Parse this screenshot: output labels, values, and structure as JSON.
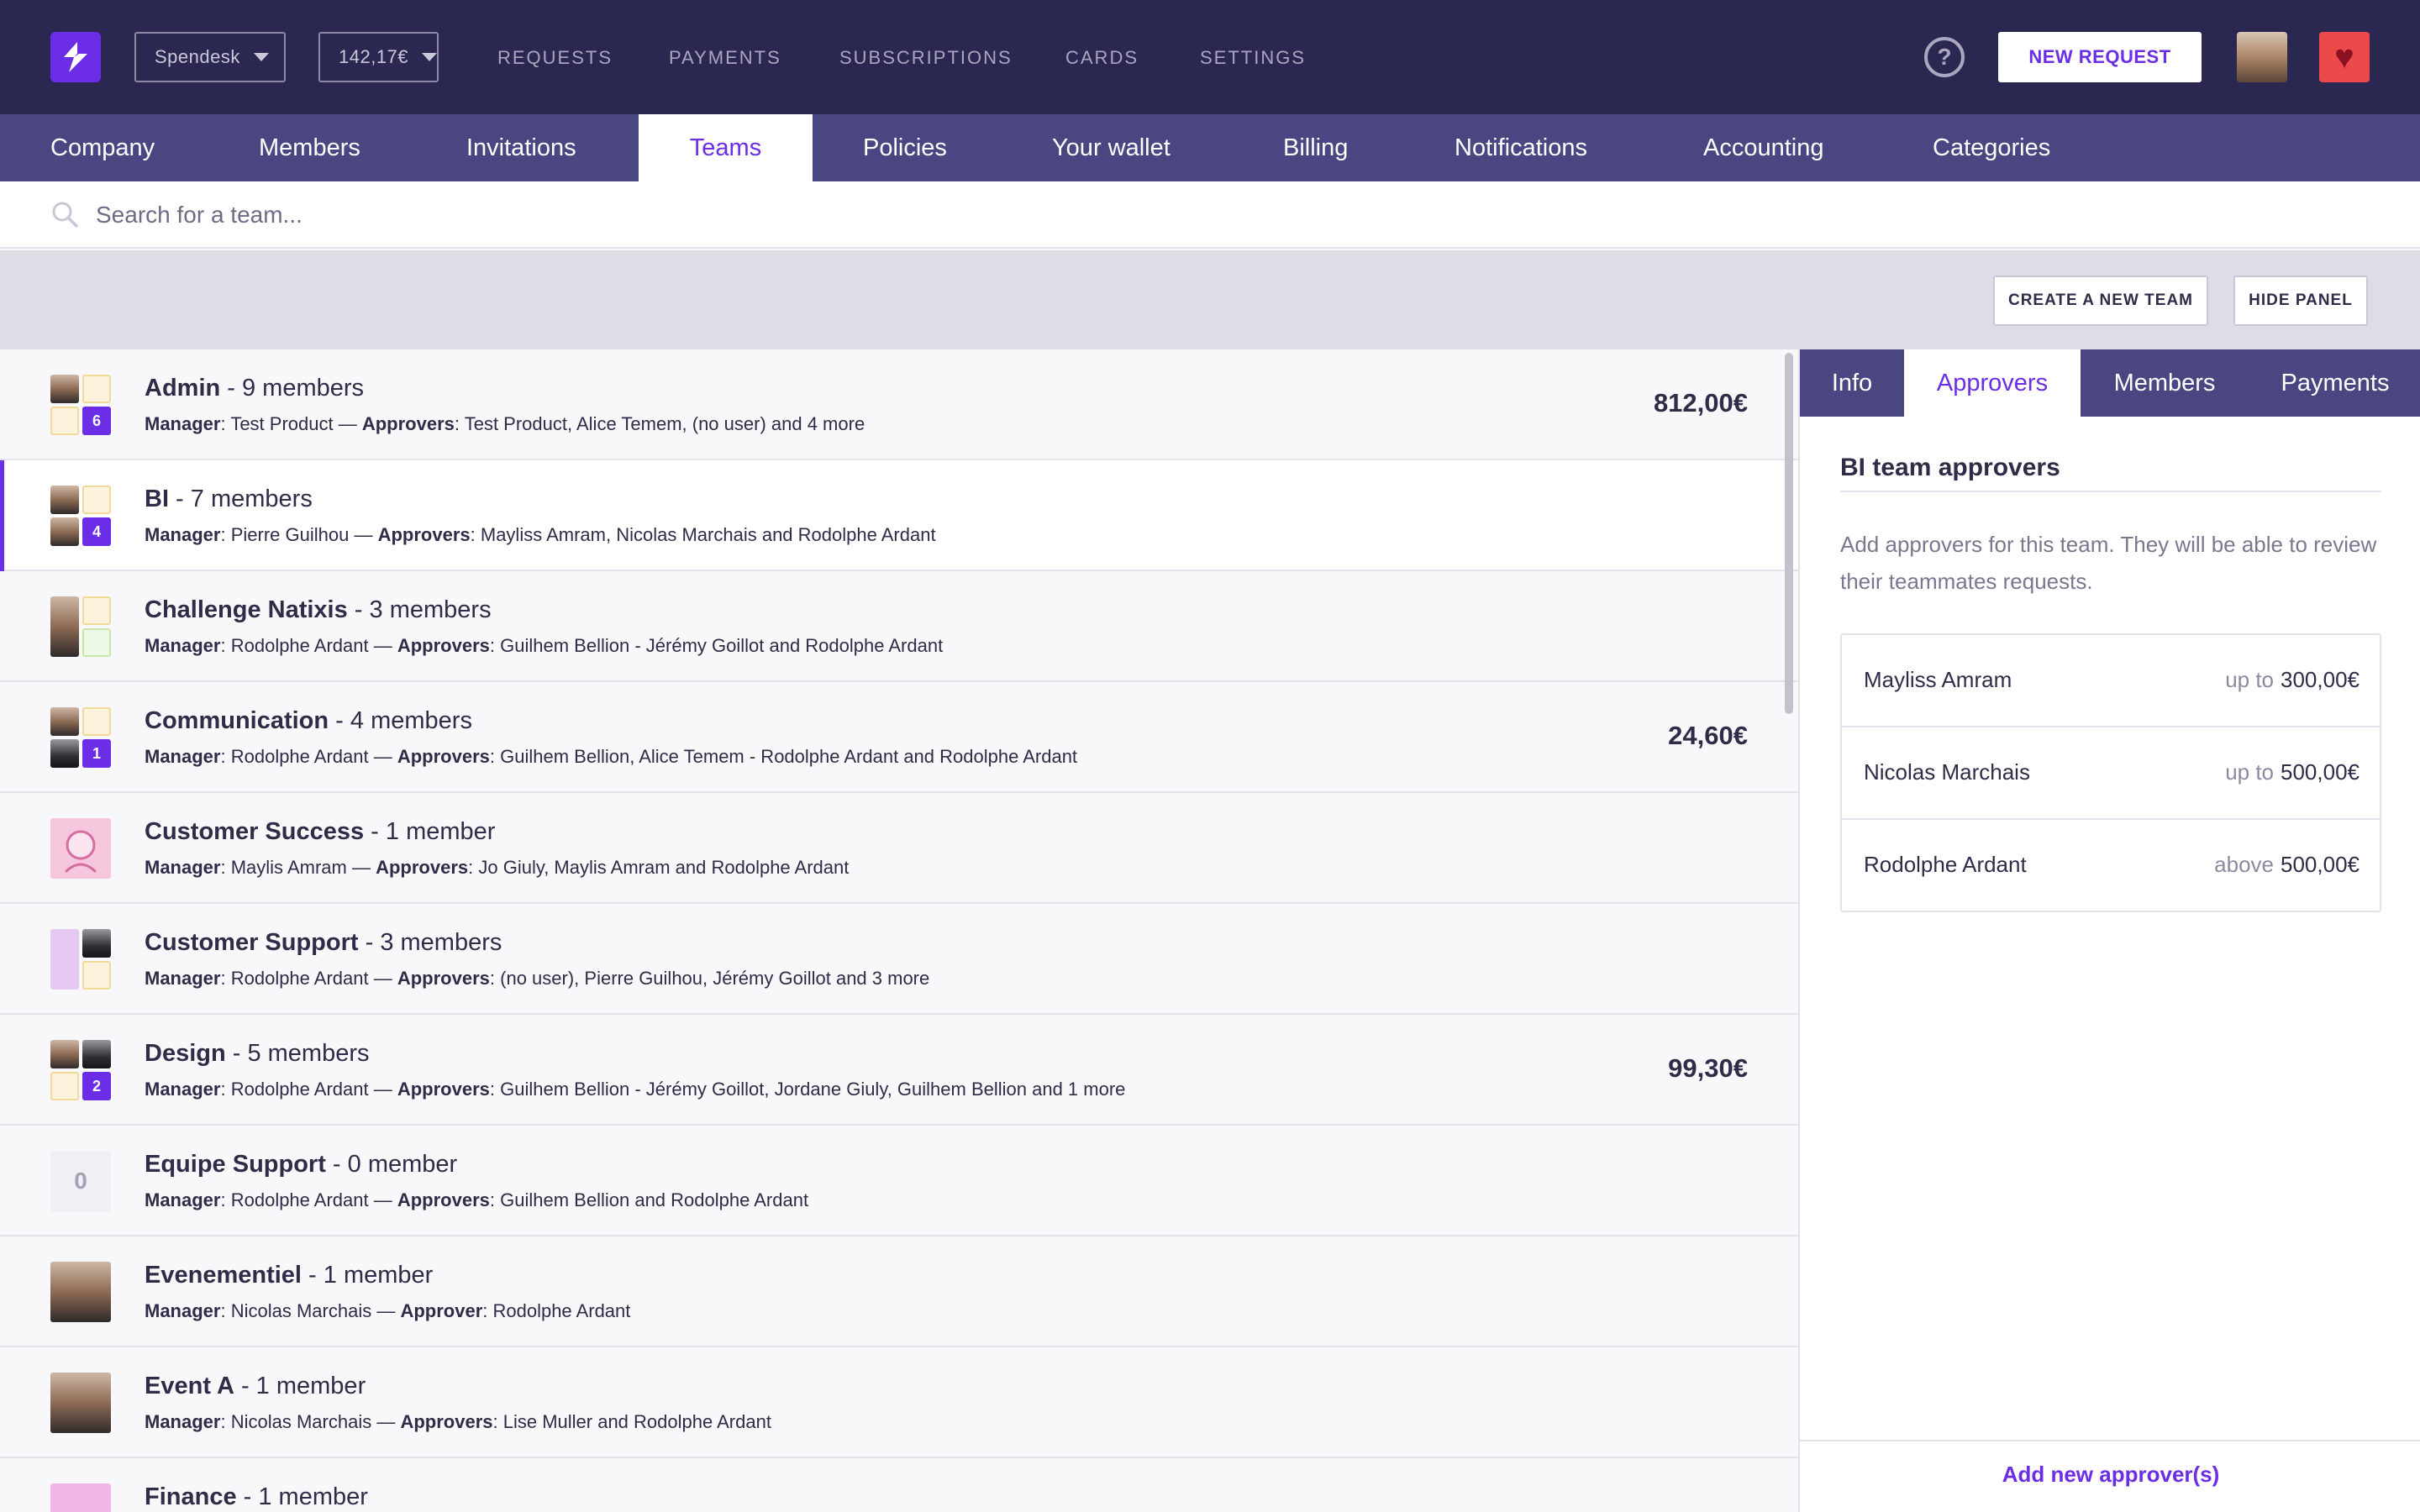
{
  "topbar": {
    "company_select": "Spendesk",
    "balance_select": "142,17€",
    "nav": [
      "REQUESTS",
      "PAYMENTS",
      "SUBSCRIPTIONS",
      "CARDS",
      "SETTINGS"
    ],
    "help_glyph": "?",
    "new_request_label": "NEW REQUEST",
    "heart_glyph": "♥"
  },
  "settings_tabs": [
    "Company",
    "Members",
    "Invitations",
    "Teams",
    "Policies",
    "Your wallet",
    "Billing",
    "Notifications",
    "Accounting",
    "Categories"
  ],
  "active_settings_tab": "Teams",
  "search": {
    "placeholder": "Search for a team..."
  },
  "actions": {
    "create_label": "CREATE A NEW TEAM",
    "hide_label": "HIDE PANEL"
  },
  "teams": [
    {
      "name": "Admin",
      "members": " - 9 members",
      "manager_label": "Manager",
      "manager": "Test Product",
      "approvers_label": "Approvers",
      "approvers": "Test Product, Alice Temem, (no user) and 4 more",
      "amount": "812,00€",
      "avatar_count": "6"
    },
    {
      "name": "BI",
      "members": " - 7 members",
      "manager_label": "Manager",
      "manager": "Pierre Guilhou",
      "approvers_label": "Approvers",
      "approvers": "Mayliss Amram, Nicolas Marchais and Rodolphe Ardant",
      "amount": "",
      "avatar_count": "4"
    },
    {
      "name": "Challenge Natixis",
      "members": " - 3 members",
      "manager_label": "Manager",
      "manager": "Rodolphe Ardant",
      "approvers_label": "Approvers",
      "approvers": "Guilhem Bellion - Jérémy Goillot and Rodolphe Ardant",
      "amount": "",
      "avatar_count": ""
    },
    {
      "name": "Communication",
      "members": " - 4 members",
      "manager_label": "Manager",
      "manager": "Rodolphe Ardant",
      "approvers_label": "Approvers",
      "approvers": "Guilhem Bellion, Alice Temem - Rodolphe Ardant and Rodolphe Ardant",
      "amount": "24,60€",
      "avatar_count": "1"
    },
    {
      "name": "Customer Success",
      "members": " - 1 member",
      "manager_label": "Manager",
      "manager": "Maylis Amram",
      "approvers_label": "Approvers",
      "approvers": "Jo Giuly, Maylis Amram and Rodolphe Ardant",
      "amount": "",
      "avatar_count": ""
    },
    {
      "name": "Customer Support",
      "members": " - 3 members",
      "manager_label": "Manager",
      "manager": "Rodolphe Ardant",
      "approvers_label": "Approvers",
      "approvers": "(no user), Pierre Guilhou, Jérémy Goillot and 3 more",
      "amount": "",
      "avatar_count": ""
    },
    {
      "name": "Design",
      "members": " - 5 members",
      "manager_label": "Manager",
      "manager": "Rodolphe Ardant",
      "approvers_label": "Approvers",
      "approvers": "Guilhem Bellion - Jérémy Goillot, Jordane Giuly, Guilhem Bellion and 1 more",
      "amount": "99,30€",
      "avatar_count": "2"
    },
    {
      "name": "Equipe Support",
      "members": " - 0 member",
      "manager_label": "Manager",
      "manager": "Rodolphe Ardant",
      "approvers_label": "Approvers",
      "approvers": "Guilhem Bellion and Rodolphe Ardant",
      "amount": "",
      "avatar_count": "0"
    },
    {
      "name": "Evenementiel",
      "members": " - 1 member",
      "manager_label": "Manager",
      "manager": "Nicolas Marchais",
      "approvers_label": "Approver",
      "approvers": "Rodolphe Ardant",
      "amount": "",
      "avatar_count": ""
    },
    {
      "name": "Event A",
      "members": " - 1 member",
      "manager_label": "Manager",
      "manager": "Nicolas Marchais",
      "approvers_label": "Approvers",
      "approvers": "Lise Muller and Rodolphe Ardant",
      "amount": "",
      "avatar_count": ""
    },
    {
      "name": "Finance",
      "members": " - 1 member",
      "manager_label": "",
      "manager": "",
      "approvers_label": "",
      "approvers": "",
      "amount": "",
      "avatar_count": ""
    }
  ],
  "selected_team": "BI",
  "panel": {
    "tabs": [
      "Info",
      "Approvers",
      "Members",
      "Payments"
    ],
    "active_tab": "Approvers",
    "title": "BI team approvers",
    "description": "Add approvers for this team. They will be able to review their teammates requests.",
    "approvers": [
      {
        "name": "Mayliss Amram",
        "prefix": "up to",
        "limit": "300,00€"
      },
      {
        "name": "Nicolas Marchais",
        "prefix": "up to",
        "limit": "500,00€"
      },
      {
        "name": "Rodolphe Ardant",
        "prefix": "above",
        "limit": "500,00€"
      }
    ],
    "add_label": "Add new approver(s)"
  },
  "colors": {
    "topbar": "#2a2850",
    "tabbar": "#4a4682",
    "accent": "#6b2ee6",
    "heart": "#ec4a4a"
  },
  "icons": [
    "spendesk-logo-icon",
    "caret-down-icon",
    "help-icon",
    "heart-icon",
    "search-icon"
  ]
}
